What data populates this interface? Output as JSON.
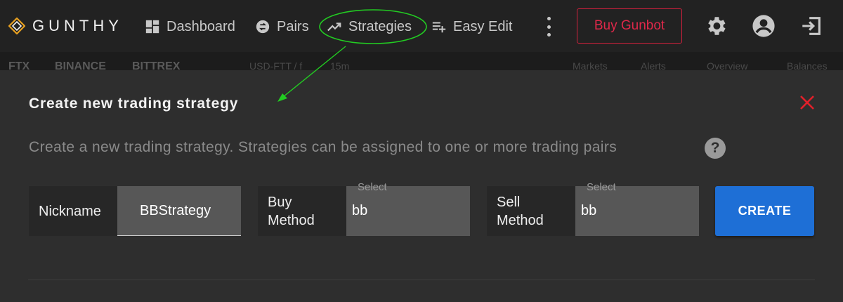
{
  "header": {
    "logo_text": "GUNTHY",
    "nav": [
      {
        "label": "Dashboard",
        "icon": "dashboard-icon"
      },
      {
        "label": "Pairs",
        "icon": "pairs-icon"
      },
      {
        "label": "Strategies",
        "icon": "trending-up-icon"
      },
      {
        "label": "Easy Edit",
        "icon": "playlist-add-icon"
      }
    ],
    "buy_label": "Buy Gunbot",
    "icons": [
      "more-vert-icon",
      "gear-icon",
      "account-icon",
      "logout-icon"
    ],
    "accent_color": "#d4213d"
  },
  "subbar": {
    "exchanges": [
      "FTX",
      "BINANCE",
      "BITTREX"
    ],
    "pair": "USD-FTT / f",
    "interval": "15m",
    "tools": [
      "Markets",
      "Alerts",
      "Overview",
      "Balances"
    ]
  },
  "modal": {
    "title": "Create new trading strategy",
    "subtitle": "Create a new trading strategy. Strategies can be assigned to one or more trading pairs",
    "help_label": "?",
    "fields": {
      "nickname": {
        "label": "Nickname",
        "value": "BBStrategy"
      },
      "buy_method": {
        "label_line1": "Buy",
        "label_line2": "Method",
        "select_label": "Select",
        "value": "bb"
      },
      "sell_method": {
        "label_line1": "Sell",
        "label_line2": "Method",
        "select_label": "Select",
        "value": "bb"
      }
    },
    "create_label": "CREATE",
    "create_color": "#1e6fd6",
    "close_color": "#e0202a"
  },
  "annotation_color": "#22cc22"
}
